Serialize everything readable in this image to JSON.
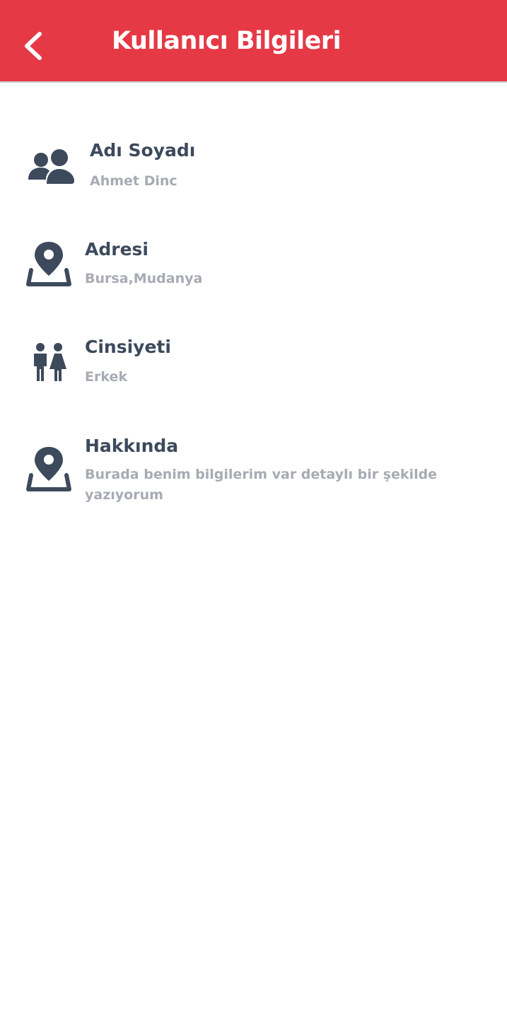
{
  "header": {
    "title": "Kullanıcı Bilgileri",
    "background": "#e63946",
    "back_icon": "chevron-left-icon"
  },
  "items": [
    {
      "title": "Adı Soyadı",
      "value": "Ahmet Dinc",
      "icon": "users-icon"
    },
    {
      "title": "Adresi",
      "value": "Bursa,Mudanya",
      "icon": "map-pin-icon"
    },
    {
      "title": "Cinsiyeti",
      "value": "Erkek",
      "icon": "restroom-icon"
    },
    {
      "title": "Hakkında",
      "value": "Burada benim bilgilerim var detaylı bir şekilde yazıyorum",
      "icon": "map-pin-icon"
    }
  ],
  "colors": {
    "title": "#3d4a5c",
    "value": "#a7abb3",
    "icon": "#3d4a5c"
  }
}
